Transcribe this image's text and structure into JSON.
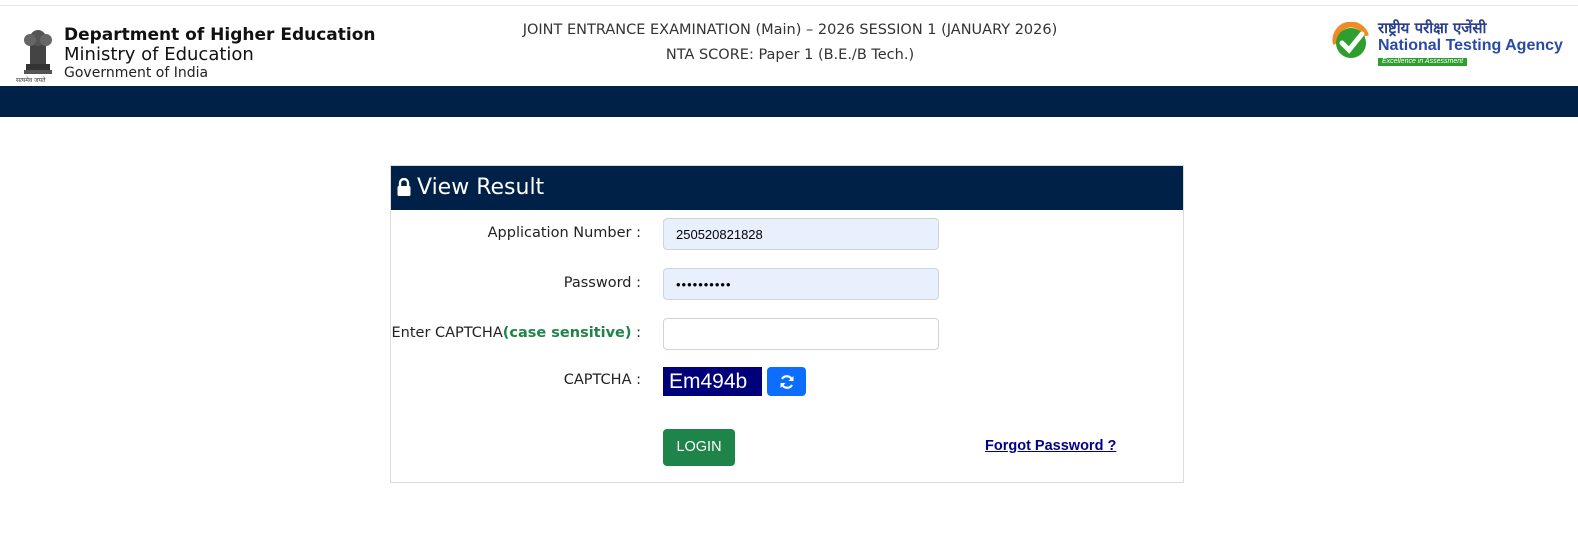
{
  "header": {
    "dept_line1": "Department of Higher Education",
    "dept_line2": "Ministry of Education",
    "dept_line3": "Government of India",
    "emblem_motto": "सत्यमेव जयते",
    "exam_title": "JOINT ENTRANCE EXAMINATION (Main) – 2026 SESSION 1 (JANUARY 2026)",
    "exam_subtitle": "NTA SCORE: Paper 1 (B.E./B Tech.)",
    "nta_hindi": "राष्ट्रीय परीक्षा एजेंसी",
    "nta_english": "National Testing Agency",
    "nta_tagline": "Excellence in Assessment"
  },
  "form": {
    "title": "View Result",
    "application_label": "Application Number :",
    "application_value": "250520821828",
    "password_label": "Password :",
    "password_value": "••••••••••",
    "captcha_input_label_prefix": "Enter CAPTCHA",
    "captcha_input_label_cs": "(case sensitive)",
    "captcha_input_label_suffix": " :",
    "captcha_input_value": "",
    "captcha_label": "CAPTCHA :",
    "captcha_text": "Em494b",
    "login_label": "LOGIN",
    "forgot_label": "Forgot Password ?"
  },
  "colors": {
    "navy": "#002147",
    "green": "#1e8449",
    "blue": "#0d6efd",
    "captcha_bg": "#00007a",
    "link": "#00008b"
  },
  "icons": [
    "lock-icon",
    "refresh-icon",
    "emblem-icon",
    "nta-check-icon"
  ]
}
